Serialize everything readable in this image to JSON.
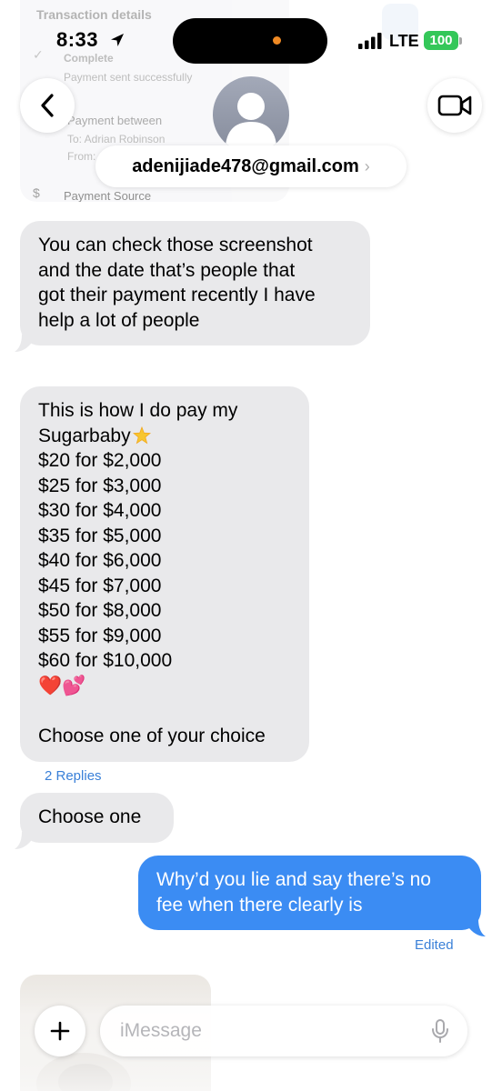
{
  "background_card": {
    "title": "Transaction details",
    "status": "Complete",
    "status_note": "Payment sent successfully",
    "section": "Payment between",
    "to_line": "To: Adrian Robinson",
    "from_line": "From:",
    "source_label": "Payment Source"
  },
  "status_bar": {
    "time": "8:33",
    "network": "LTE",
    "battery": "100"
  },
  "header": {
    "contact": "adenijiade478@gmail.com",
    "chevron": "›"
  },
  "messages": [
    {
      "direction": "incoming",
      "lines": [
        "You can check those screenshot",
        "and the date that’s people that",
        "got their payment recently I have",
        "help a lot of people"
      ]
    },
    {
      "direction": "incoming",
      "lines": [
        "This is how I do pay my",
        "Sugarbaby",
        "$20 for $2,000",
        "$25 for $3,000",
        "$30 for $4,000",
        "$35 for $5,000",
        "$40 for $6,000",
        "$45 for $7,000",
        "$50 for $8,000",
        "$55 for $9,000",
        "$60 for $10,000",
        "❤️💕",
        "",
        "Choose one of your choice"
      ],
      "replies": "2 Replies"
    },
    {
      "direction": "incoming",
      "lines": [
        "Choose one"
      ]
    },
    {
      "direction": "outgoing",
      "lines": [
        "Why’d you lie and say there’s no",
        "fee when there clearly is"
      ],
      "status": "Edited"
    }
  ],
  "composer": {
    "placeholder": "iMessage"
  },
  "colors": {
    "incoming_bubble": "#e9e9eb",
    "outgoing_bubble": "#3b8cf3",
    "link_blue": "#3a80d8",
    "battery_green": "#34c759"
  },
  "icons": [
    "back-chevron-icon",
    "video-camera-icon",
    "location-arrow-icon",
    "signal-bars-icon",
    "plus-icon",
    "microphone-icon",
    "sparkle-star-icon"
  ]
}
